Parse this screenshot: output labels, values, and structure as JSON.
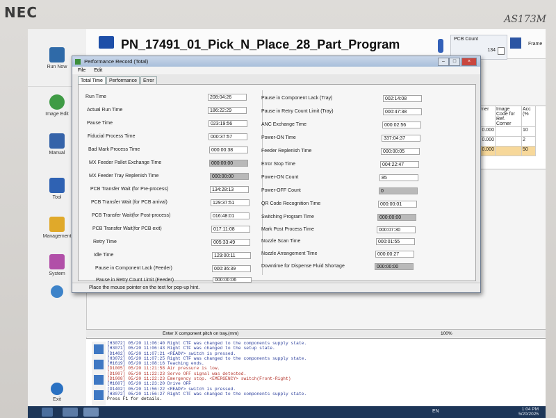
{
  "monitor": {
    "brand": "NEC",
    "model": "AS173M"
  },
  "topbar": {
    "program_title": "PN_17491_01_Pick_N_Place_28_Part_Program",
    "pcb_count_label": "PCB Count",
    "pcb_count_value": "134",
    "frame_label": "Frame"
  },
  "nav": {
    "items": [
      "Run Now",
      "Image Edit",
      "Manual",
      "Tool",
      "Management",
      "System",
      "Exit"
    ]
  },
  "right_table": {
    "headers": [
      "Corner",
      "Image Code for Ref. Corner",
      "Acc (%"
    ],
    "rows": [
      [
        "0.000",
        "10"
      ],
      [
        "0.000",
        "2"
      ],
      [
        "0.000",
        "50"
      ]
    ]
  },
  "dialog": {
    "title": "Performance Record (Total)",
    "menu": [
      "File",
      "Edit"
    ],
    "tabs": [
      "Total Time",
      "Performance",
      "Error"
    ],
    "left": [
      {
        "label": "Run Time",
        "value": "208:04:26",
        "disabled": false
      },
      {
        "label": "Actual Run Time",
        "value": "186:22:29",
        "disabled": false
      },
      {
        "label": "Pause Time",
        "value": "023:19:56",
        "disabled": false
      },
      {
        "label": "Fiducial Process Time",
        "value": "000:37:57",
        "disabled": false
      },
      {
        "label": "Bad Mark Process Time",
        "value": "000:00:38",
        "disabled": false
      },
      {
        "label": "MX Feeder Pallet Exchange Time",
        "value": "000:00:00",
        "disabled": true
      },
      {
        "label": "MX Feeder Tray Replenish Time",
        "value": "000:00:00",
        "disabled": true
      },
      {
        "label": "PCB Transfer Wait (for Pre-process)",
        "value": "134:28:13",
        "disabled": false
      },
      {
        "label": "PCB Transfer Wait (for PCB arrival)",
        "value": "129:37:51",
        "disabled": false
      },
      {
        "label": "PCB Transfer Wait(for Post-process)",
        "value": "016:48:01",
        "disabled": false
      },
      {
        "label": "PCB Transfer Wait(for PCB exit)",
        "value": "017:11:08",
        "disabled": false
      },
      {
        "label": "Retry Time",
        "value": "005:33:49",
        "disabled": false
      },
      {
        "label": "Idle Time",
        "value": "129:00:11",
        "disabled": false
      },
      {
        "label": "Pause in Component Lack (Feeder)",
        "value": "000:36:39",
        "disabled": false
      },
      {
        "label": "Pause in Retry Count Limit (Feeder)",
        "value": "000:00:06",
        "disabled": false
      }
    ],
    "right": [
      {
        "label": "Pause in Component Lack (Tray)",
        "value": "002:14:08",
        "disabled": false
      },
      {
        "label": "Pause in Retry Count Limit (Tray)",
        "value": "000:47:38",
        "disabled": false
      },
      {
        "label": "ANC Exchange Time",
        "value": "000:02:56",
        "disabled": false
      },
      {
        "label": "Power-ON Time",
        "value": "337:04:37",
        "disabled": false
      },
      {
        "label": "Feeder Replenish Time",
        "value": "000:00:05",
        "disabled": false
      },
      {
        "label": "Error Stop Time",
        "value": "004:22:47",
        "disabled": false
      },
      {
        "label": "Power-ON Count",
        "value": "85",
        "disabled": false
      },
      {
        "label": "Power-OFF Count",
        "value": "0",
        "disabled": true
      },
      {
        "label": "QR Code Recognition Time",
        "value": "000:00:01",
        "disabled": false
      },
      {
        "label": "Switching Program Time",
        "value": "000:00:00",
        "disabled": true
      },
      {
        "label": "Mark Post Process Time",
        "value": "000:07:30",
        "disabled": false
      },
      {
        "label": "Nozzle Scan Time",
        "value": "000:01:55",
        "disabled": false
      },
      {
        "label": "Nozzle Arrangement Time",
        "value": "000:00:27",
        "disabled": false
      },
      {
        "label": "Downtime for Dispense Fluid Shortage",
        "value": "000:00:00",
        "disabled": true
      }
    ],
    "status": "Place the mouse pointer on the text for pop-up hint."
  },
  "hint_bar": {
    "text": "Enter X component pitch on tray.(mm)",
    "zoom": "100%"
  },
  "log": [
    {
      "text": "[H3072]  05/20 11:06:40  Right CTF was changed to the components supply state.",
      "level": "info"
    },
    {
      "text": "[H3071]  05/20 11:06:43  Right CTF was changed to the setup state.",
      "level": "info"
    },
    {
      "text": "[D1402]  05/20 11:07:21  <READY> switch is pressed.",
      "level": "info"
    },
    {
      "text": "[H3072]  05/20 11:07:25  Right CTF was changed to the components supply state.",
      "level": "info"
    },
    {
      "text": "[M1619]  05/20 11:08:16  Teaching ends.",
      "level": "info"
    },
    {
      "text": "[D1005]  05/20 11:21:58  Air pressure is low.",
      "level": "error"
    },
    {
      "text": "[D1007]  05/20 11:22:23  Servo OFF signal was detected.",
      "level": "error"
    },
    {
      "text": "[D1008]  05/20 11:22:23  Emergency stop. <EMERGENCY> switch(Front-Right)",
      "level": "error"
    },
    {
      "text": "[M1607]  05/20 11:23:20  Drive OFF",
      "level": "info"
    },
    {
      "text": "[D1402]  05/20 11:56:22  <READY> switch is pressed.",
      "level": "info"
    },
    {
      "text": "[H3072]  05/20 11:56:27  Right CTF was changed to the components supply state.",
      "level": "info"
    },
    {
      "text": "Press F1 for details.",
      "level": "info"
    }
  ],
  "taskbar": {
    "lang": "EN",
    "time": "1:04 PM",
    "date": "5/20/2025"
  }
}
